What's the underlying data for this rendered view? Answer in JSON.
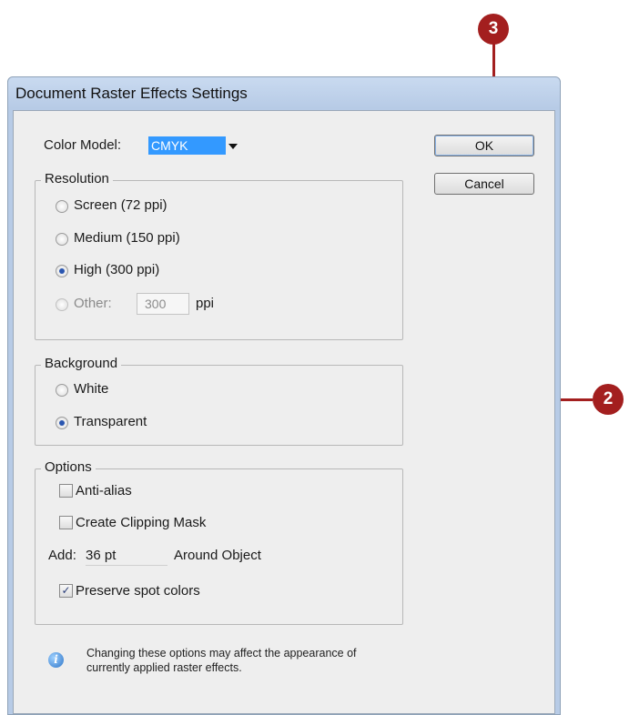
{
  "window": {
    "title": "Document Raster Effects Settings"
  },
  "color_model": {
    "label": "Color Model:",
    "value": "CMYK"
  },
  "buttons": {
    "ok": "OK",
    "cancel": "Cancel"
  },
  "resolution": {
    "legend": "Resolution",
    "options": [
      "Screen (72 ppi)",
      "Medium (150 ppi)",
      "High (300 ppi)",
      "Other:"
    ],
    "selected": "High (300 ppi)",
    "other_value": "300",
    "other_unit": "ppi"
  },
  "background": {
    "legend": "Background",
    "options": [
      "White",
      "Transparent"
    ],
    "selected": "Transparent"
  },
  "options": {
    "legend": "Options",
    "anti_alias": {
      "label": "Anti-alias",
      "checked": false
    },
    "clipping_mask": {
      "label": "Create Clipping Mask",
      "checked": false
    },
    "add_label": "Add:",
    "add_value": "36 pt",
    "around_label": "Around Object",
    "preserve_spot": {
      "label": "Preserve spot colors",
      "checked": true
    }
  },
  "note": {
    "line1": "Changing these options may affect the appearance of",
    "line2": "currently applied raster effects."
  },
  "callouts": {
    "step_a": "3",
    "step_b": "2"
  },
  "colors": {
    "callout": "#a31f1f",
    "selection": "#3399ff"
  }
}
